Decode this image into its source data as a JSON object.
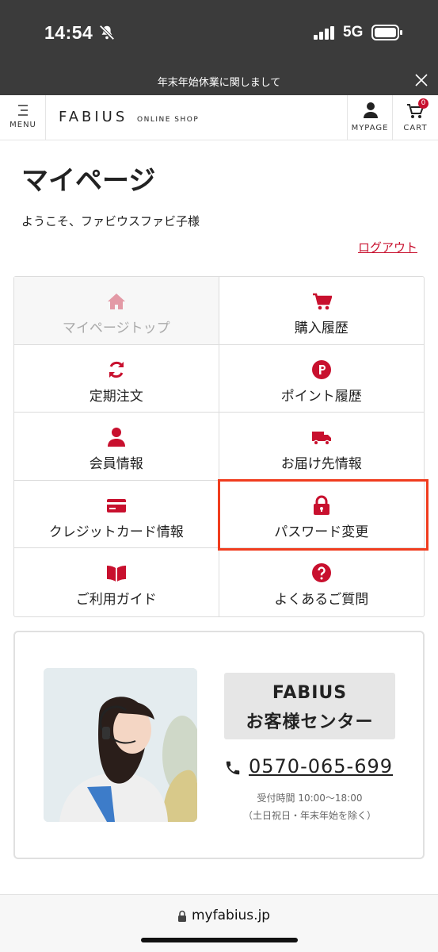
{
  "status": {
    "time": "14:54",
    "network": "5G"
  },
  "notice": {
    "text": "年末年始休業に関しまして"
  },
  "header": {
    "menu_label": "MENU",
    "logo_main": "FABIUS",
    "logo_sub": "ONLINE SHOP",
    "mypage_label": "MYPAGE",
    "cart_label": "CART",
    "cart_count": "0"
  },
  "page": {
    "title": "マイページ",
    "welcome": "ようこそ、ファビウスファビ子様",
    "logout": "ログアウト"
  },
  "menu": {
    "items": [
      {
        "label": "マイページトップ",
        "icon": "home-icon"
      },
      {
        "label": "購入履歴",
        "icon": "cart-icon"
      },
      {
        "label": "定期注文",
        "icon": "refresh-icon"
      },
      {
        "label": "ポイント履歴",
        "icon": "point-icon"
      },
      {
        "label": "会員情報",
        "icon": "user-icon"
      },
      {
        "label": "お届け先情報",
        "icon": "truck-icon"
      },
      {
        "label": "クレジットカード情報",
        "icon": "credit-card-icon"
      },
      {
        "label": "パスワード変更",
        "icon": "lock-icon"
      },
      {
        "label": "ご利用ガイド",
        "icon": "book-icon"
      },
      {
        "label": "よくあるご質問",
        "icon": "question-icon"
      }
    ]
  },
  "support": {
    "brand": "FABIUS",
    "center": "お客様センター",
    "phone": "0570-065-699",
    "hours": "受付時間 10:00〜18:00",
    "note": "（土日祝日・年末年始を除く）"
  },
  "browser": {
    "url": "myfabius.jp"
  },
  "colors": {
    "accent": "#c8102e",
    "highlight": "#f03c1e",
    "dark_bar": "#3b3b3b"
  }
}
